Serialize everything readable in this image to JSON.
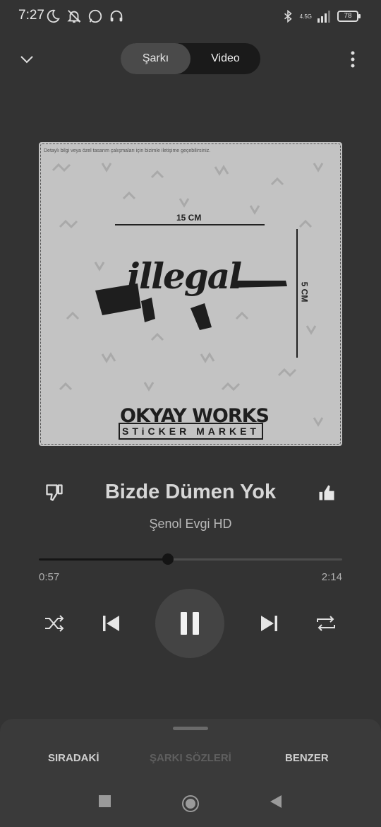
{
  "status": {
    "time": "7:27",
    "network_label": "4.5G",
    "battery": "78"
  },
  "topbar": {
    "tab_song": "Şarkı",
    "tab_video": "Video"
  },
  "artwork": {
    "note": "Detaylı bilgi veya özel tasarım çalışmaları için bizimle iletişime geçebilirsiniz.",
    "dim_horizontal": "15 CM",
    "dim_vertical": "5 CM",
    "logo_text": "illegal",
    "brand_line1": "OKYAY WORKS",
    "brand_line2": "STiCKER MARKET"
  },
  "song": {
    "title": "Bizde Dümen Yok",
    "artist": "Şenol Evgi HD"
  },
  "progress": {
    "elapsed": "0:57",
    "duration": "2:14",
    "fraction": 0.425
  },
  "sheet": {
    "tab_up_next": "SIRADAKİ",
    "tab_lyrics": "ŞARKI SÖZLERİ",
    "tab_related": "BENZER"
  }
}
